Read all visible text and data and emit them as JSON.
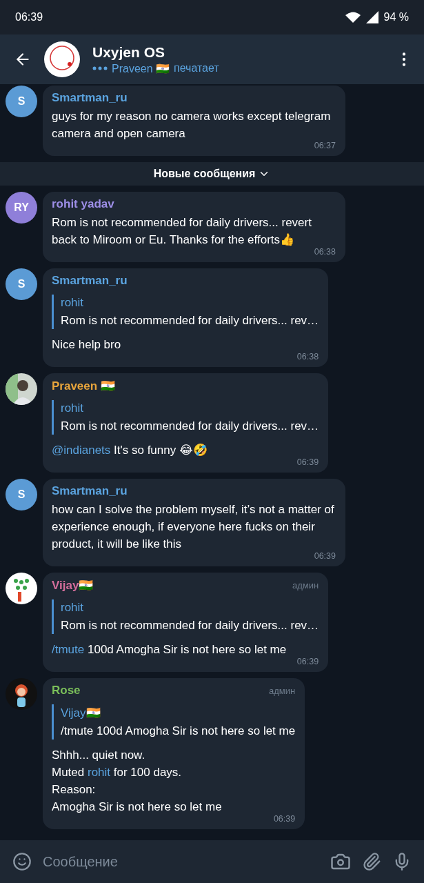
{
  "status_bar": {
    "time": "06:39",
    "battery": "94 %"
  },
  "header": {
    "title": "Uxyjen OS",
    "typing_name": "Praveen 🇮🇳",
    "typing_text": "печатает"
  },
  "new_messages_divider": "Новые сообщения",
  "messages": [
    {
      "avatar": {
        "kind": "initials",
        "text": "S",
        "color": "#5b9bd5"
      },
      "sender": "Smartman_ru",
      "color": "#5ba4e0",
      "lines": [
        [
          {
            "kind": "plain",
            "text": "guys for my reason no camera works except telegram camera and open camera"
          }
        ]
      ],
      "time": "06:37"
    },
    {
      "avatar": {
        "kind": "initials",
        "text": "RY",
        "color": "#8f7fd9"
      },
      "sender": "rohit yadav",
      "color": "#9e8fe8",
      "lines": [
        [
          {
            "kind": "plain",
            "text": "Rom is not recommended for daily drivers... revert back to Miroom or Eu. Thanks for the efforts👍"
          }
        ]
      ],
      "time": "06:38"
    },
    {
      "avatar": {
        "kind": "initials",
        "text": "S",
        "color": "#5b9bd5"
      },
      "sender": "Smartman_ru",
      "color": "#5ba4e0",
      "reply": {
        "name": "rohit",
        "text": "Rom is not recommended for daily drivers... rev…"
      },
      "lines": [
        [
          {
            "kind": "plain",
            "text": "Nice help bro"
          }
        ]
      ],
      "time": "06:38"
    },
    {
      "avatar": {
        "kind": "picture"
      },
      "sender": "Praveen 🇮🇳",
      "color": "#e8a53c",
      "reply": {
        "name": "rohit",
        "text": "Rom is not recommended for daily drivers... rev…"
      },
      "lines": [
        [
          {
            "kind": "link",
            "text": "@indianets"
          },
          {
            "kind": "plain",
            "text": " It's so funny 😂🤣"
          }
        ]
      ],
      "time": "06:39"
    },
    {
      "avatar": {
        "kind": "initials",
        "text": "S",
        "color": "#5b9bd5"
      },
      "sender": "Smartman_ru",
      "color": "#5ba4e0",
      "lines": [
        [
          {
            "kind": "plain",
            "text": "how can I solve the problem myself, it’s not a matter of experience enough, if everyone here fucks on their product, it will be like this"
          }
        ]
      ],
      "time": "06:39"
    },
    {
      "avatar": {
        "kind": "picture"
      },
      "sender": "Vijay🇮🇳",
      "color": "#d66f9c",
      "badge": "админ",
      "reply": {
        "name": "rohit",
        "text": "Rom is not recommended for daily drivers... rev…"
      },
      "lines": [
        [
          {
            "kind": "link",
            "text": "/tmute"
          },
          {
            "kind": "plain",
            "text": " 100d Amogha Sir is not here so let me"
          }
        ]
      ],
      "time": "06:39"
    },
    {
      "avatar": {
        "kind": "picture"
      },
      "sender": "Rose",
      "color": "#7bbf5a",
      "badge": "админ",
      "reply": {
        "name": "Vijay🇮🇳",
        "text": "/tmute 100d Amogha Sir is not here so let me"
      },
      "lines": [
        [
          {
            "kind": "plain",
            "text": "Shhh... quiet now."
          }
        ],
        [
          {
            "kind": "plain",
            "text": "Muted "
          },
          {
            "kind": "link",
            "text": "rohit"
          },
          {
            "kind": "plain",
            "text": " for 100 days."
          }
        ],
        [
          {
            "kind": "plain",
            "text": "Reason:"
          }
        ],
        [
          {
            "kind": "plain",
            "text": "Amogha Sir is not here so let me"
          }
        ]
      ],
      "time": "06:39"
    }
  ],
  "composer": {
    "placeholder": "Сообщение"
  }
}
